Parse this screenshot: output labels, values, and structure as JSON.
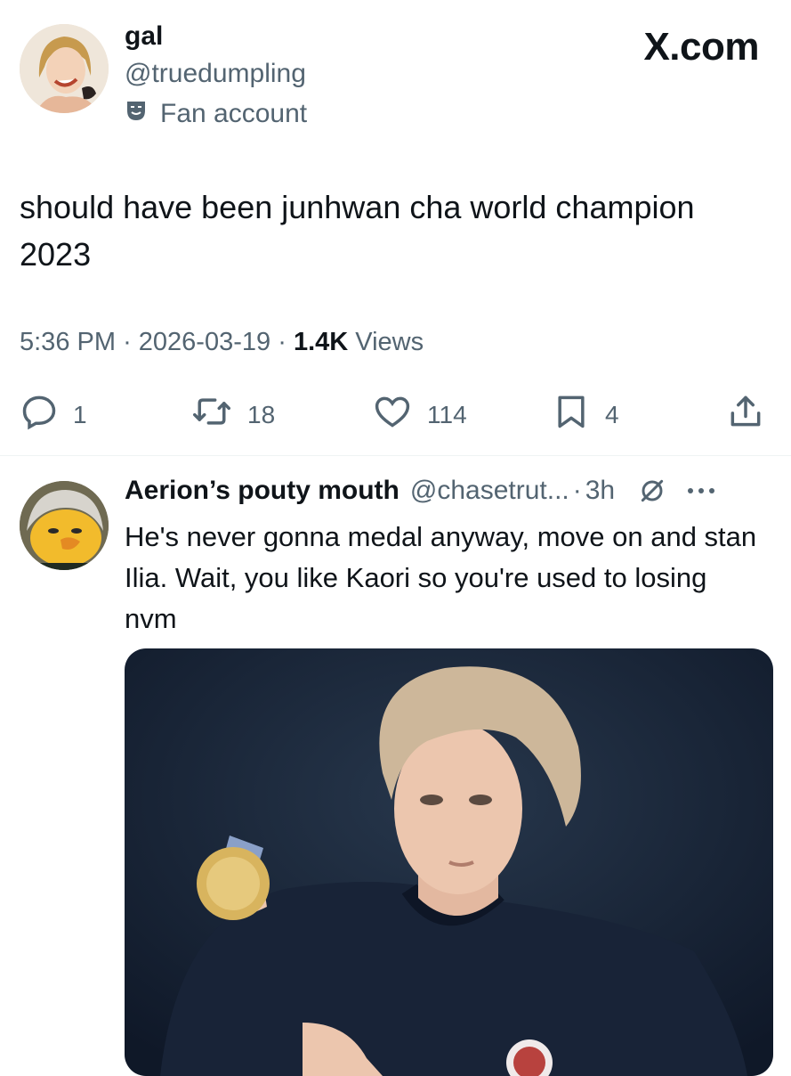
{
  "header": {
    "brand": "X.com"
  },
  "post": {
    "author_name": "gal",
    "author_handle": "@truedumpling",
    "account_label": "Fan account",
    "text": "should have been junhwan cha world champion 2023",
    "time": "5:36 PM",
    "date": "2026-03-19",
    "views_count": "1.4K",
    "views_label": "Views",
    "separator": "·",
    "stats": {
      "replies": "1",
      "reposts": "18",
      "likes": "114",
      "bookmarks": "4"
    }
  },
  "reply": {
    "author_name": "Aerion’s pouty mouth",
    "author_handle": "@chasetrut...",
    "time": "3h",
    "text": "He's never gonna medal anyway, move on and stan Ilia. Wait, you like Kaori so you're used to losing nvm"
  },
  "colors": {
    "text": "#0f1419",
    "secondary": "#536471",
    "divider": "#eff3f4"
  },
  "icons": [
    "comedy-mask-icon",
    "reply-icon",
    "repost-icon",
    "like-icon",
    "bookmark-icon",
    "share-icon",
    "muted-icon",
    "more-icon"
  ]
}
